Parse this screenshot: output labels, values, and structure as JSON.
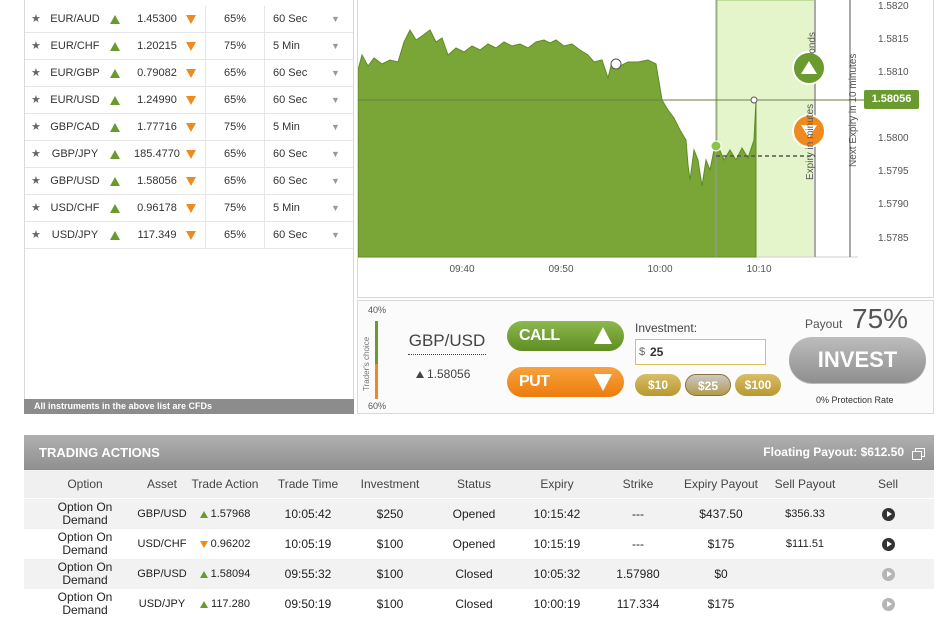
{
  "instruments": [
    {
      "name": "EUR/AUD",
      "price": "1.45300",
      "payout": "65%",
      "duration": "60 Sec"
    },
    {
      "name": "EUR/CHF",
      "price": "1.20215",
      "payout": "75%",
      "duration": "5 Min"
    },
    {
      "name": "EUR/GBP",
      "price": "0.79082",
      "payout": "65%",
      "duration": "60 Sec"
    },
    {
      "name": "EUR/USD",
      "price": "1.24990",
      "payout": "65%",
      "duration": "60 Sec"
    },
    {
      "name": "GBP/CAD",
      "price": "1.77716",
      "payout": "75%",
      "duration": "5 Min"
    },
    {
      "name": "GBP/JPY",
      "price": "185.4770",
      "payout": "65%",
      "duration": "60 Sec"
    },
    {
      "name": "GBP/USD",
      "price": "1.58056",
      "payout": "65%",
      "duration": "60 Sec"
    },
    {
      "name": "USD/CHF",
      "price": "0.96178",
      "payout": "75%",
      "duration": "5 Min"
    },
    {
      "name": "USD/JPY",
      "price": "117.349",
      "payout": "65%",
      "duration": "60 Sec"
    }
  ],
  "cfd_note": "All instruments in the above list are CFDs",
  "chart": {
    "y_ticks": [
      "1.5820",
      "1.5815",
      "1.5810",
      "1.5805",
      "1.5800",
      "1.5795",
      "1.5790",
      "1.5785"
    ],
    "x_ticks": [
      "09:40",
      "09:50",
      "10:00",
      "10:10"
    ],
    "current_price": "1.58056",
    "expiry_label": "Expiry in minutes",
    "seconds_label": "onds",
    "next_expiry_label": "Next Expiry in 10 minutes",
    "colors": {
      "area": "#7aa637",
      "expiry_zone": "#e4f5cc",
      "up": "#6b9a2e",
      "down": "#f08a1e"
    }
  },
  "trade_panel": {
    "traders_choice_top": "40%",
    "traders_choice_bottom": "60%",
    "traders_choice_label": "Trader's choice",
    "asset": "GBP/USD",
    "asset_price": "1.58056",
    "call_label": "CALL",
    "put_label": "PUT",
    "investment_label": "Investment:",
    "investment_value": "25",
    "currency_symbol": "$",
    "amounts": [
      "$10",
      "$25",
      "$100"
    ],
    "payout_label": "Payout",
    "payout_value": "75%",
    "invest_label": "INVEST",
    "protection": "0% Protection Rate"
  },
  "actions": {
    "title": "TRADING ACTIONS",
    "floating_payout": "Floating Payout:  $612.50",
    "columns": [
      "Option",
      "Asset",
      "Trade Action",
      "Trade Time",
      "Investment",
      "Status",
      "Expiry",
      "Strike",
      "Expiry Payout",
      "Sell Payout",
      "Sell"
    ],
    "rows": [
      {
        "option": "Option On Demand",
        "asset": "GBP/USD",
        "direction": "up",
        "action": "1.57968",
        "time": "10:05:42",
        "investment": "$250",
        "status": "Opened",
        "expiry": "10:15:42",
        "strike": "---",
        "expiry_payout": "$437.50",
        "sell_payout": "$356.33",
        "sell_enabled": true
      },
      {
        "option": "Option On Demand",
        "asset": "USD/CHF",
        "direction": "down",
        "action": "0.96202",
        "time": "10:05:19",
        "investment": "$100",
        "status": "Opened",
        "expiry": "10:15:19",
        "strike": "---",
        "expiry_payout": "$175",
        "sell_payout": "$111.51",
        "sell_enabled": true
      },
      {
        "option": "Option On Demand",
        "asset": "GBP/USD",
        "direction": "up",
        "action": "1.58094",
        "time": "09:55:32",
        "investment": "$100",
        "status": "Closed",
        "expiry": "10:05:32",
        "strike": "1.57980",
        "expiry_payout": "$0",
        "sell_payout": "",
        "sell_enabled": false
      },
      {
        "option": "Option On Demand",
        "asset": "USD/JPY",
        "direction": "up",
        "action": "117.280",
        "time": "09:50:19",
        "investment": "$100",
        "status": "Closed",
        "expiry": "10:00:19",
        "strike": "117.334",
        "expiry_payout": "$175",
        "sell_payout": "",
        "sell_enabled": false
      }
    ]
  }
}
